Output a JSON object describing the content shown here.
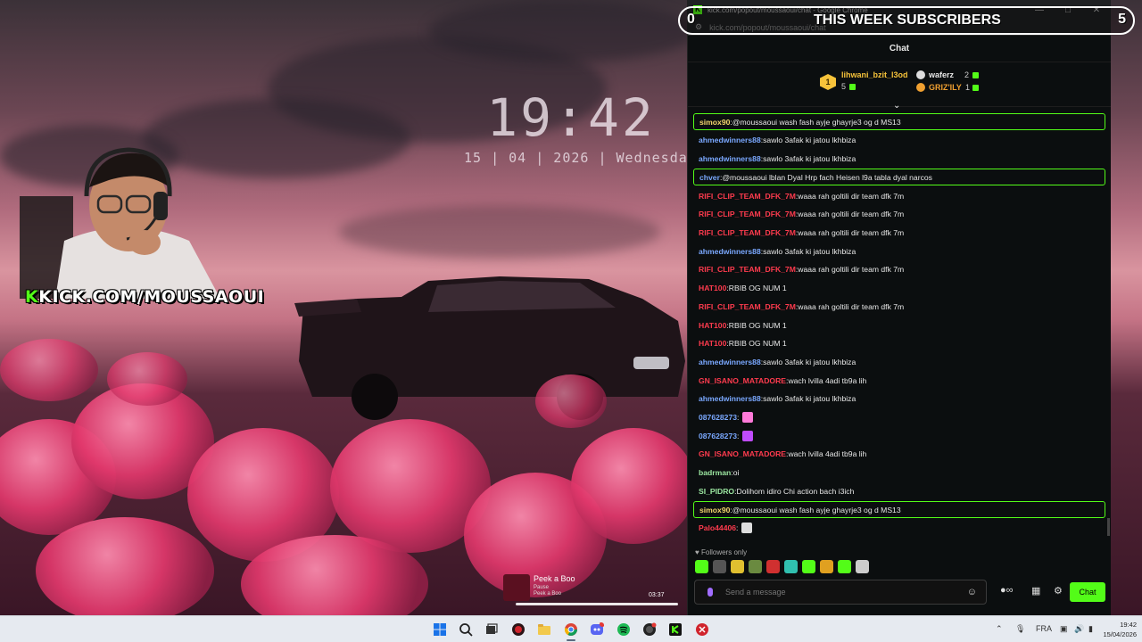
{
  "wallpaper": {
    "time": "19:42",
    "date": "15 | 04 | 2026 | Wednesday"
  },
  "overlay": {
    "brand_k": "K",
    "brand_text": "KICK.COM/MOUSSAOUI",
    "subs_title": "THIS WEEK SUBSCRIBERS",
    "subs_left": "0",
    "subs_right": "5"
  },
  "now_playing": {
    "title": "Peek a Boo",
    "status": "Pause",
    "artist": "Peek a Boo",
    "duration": "03:37"
  },
  "browser": {
    "window_title": "kick.com/popout/moussaoui/chat - Google Chrome",
    "url": "kick.com/popout/moussaoui/chat",
    "favicon": "K"
  },
  "chat": {
    "header": "Chat",
    "leaderboard": [
      {
        "name": "lihwani_bzit_l3od",
        "count": "5",
        "rank": "1",
        "color": "#f7c33a"
      },
      {
        "name": "waferz",
        "count": "2",
        "color": "#e8e8e8"
      },
      {
        "name": "GRIZ'ILY",
        "count": "1",
        "color": "#f0a030"
      }
    ],
    "messages": [
      {
        "user": "simox90",
        "text": "@moussaoui wash fash ayje ghayrje3 og d MS13",
        "color": "#f5d76e",
        "highlight": true
      },
      {
        "user": "ahmedwinners88",
        "text": "sawlo 3afak ki jatou lkhbiza",
        "color": "#7aa8ff"
      },
      {
        "user": "ahmedwinners88",
        "text": "sawlo 3afak ki jatou lkhbiza",
        "color": "#7aa8ff"
      },
      {
        "user": "chver",
        "text": "@moussaoui lblan Dyal Hrp fach Heisen l9a tabla dyal narcos",
        "color": "#7aa8ff",
        "highlight": true
      },
      {
        "user": "RIFI_CLIP_TEAM_DFK_7M",
        "text": "waaa rah goltili dir team dfk 7m",
        "color": "#ff3b4e"
      },
      {
        "user": "RIFI_CLIP_TEAM_DFK_7M",
        "text": "waaa rah goltili dir team dfk 7m",
        "color": "#ff3b4e"
      },
      {
        "user": "RIFI_CLIP_TEAM_DFK_7M",
        "text": "waaa rah goltili dir team dfk 7m",
        "color": "#ff3b4e"
      },
      {
        "user": "ahmedwinners88",
        "text": "sawlo 3afak ki jatou lkhbiza",
        "color": "#7aa8ff"
      },
      {
        "user": "RIFI_CLIP_TEAM_DFK_7M",
        "text": "waaa rah goltili dir team dfk 7m",
        "color": "#ff3b4e"
      },
      {
        "user": "HAT100",
        "text": "RBIB OG NUM 1",
        "color": "#ff3b4e"
      },
      {
        "user": "RIFI_CLIP_TEAM_DFK_7M",
        "text": "waaa rah goltili dir team dfk 7m",
        "color": "#ff3b4e"
      },
      {
        "user": "HAT100",
        "text": "RBIB OG NUM 1",
        "color": "#ff3b4e"
      },
      {
        "user": "HAT100",
        "text": "RBIB OG NUM 1",
        "color": "#ff3b4e"
      },
      {
        "user": "ahmedwinners88",
        "text": "sawlo 3afak ki jatou lkhbiza",
        "color": "#7aa8ff"
      },
      {
        "user": "GN_ISANO_MATADORE",
        "text": "wach lvilla 4adi tb9a lih",
        "color": "#ff3b4e"
      },
      {
        "user": "ahmedwinners88",
        "text": "sawlo 3afak ki jatou lkhbiza",
        "color": "#7aa8ff"
      },
      {
        "user": "087628273",
        "text": "",
        "color": "#7aa8ff",
        "emote": "#ff7ad9"
      },
      {
        "user": "087628273",
        "text": "",
        "color": "#7aa8ff",
        "emote": "#c04cff"
      },
      {
        "user": "GN_ISANO_MATADORE",
        "text": "wach lvilla 4adi tb9a lih",
        "color": "#ff3b4e"
      },
      {
        "user": "badrman",
        "text": "oi",
        "color": "#9be6a0"
      },
      {
        "user": "SI_PIDRO",
        "text": "Dolihom idiro Chi action bach i3ich",
        "color": "#9be6a0"
      },
      {
        "user": "simox90",
        "text": "@moussaoui wash fash ayje ghayrje3 og d MS13",
        "color": "#f5d76e",
        "highlight": true
      },
      {
        "user": "Palo44406",
        "text": "",
        "color": "#ff3b4e",
        "emote": "#dddddd"
      }
    ],
    "followers_only": "Followers only",
    "composer_placeholder": "Send a message",
    "send_label": "Chat",
    "emote_colors": [
      "#53fc18",
      "#555",
      "#e0c030",
      "#6a8a40",
      "#d03030",
      "#30c0b0",
      "#53fc18",
      "#e0a020",
      "#53fc18",
      "#cccccc"
    ]
  },
  "taskbar": {
    "lang": "FRA",
    "time": "19:42",
    "date": "15/04/2026"
  }
}
